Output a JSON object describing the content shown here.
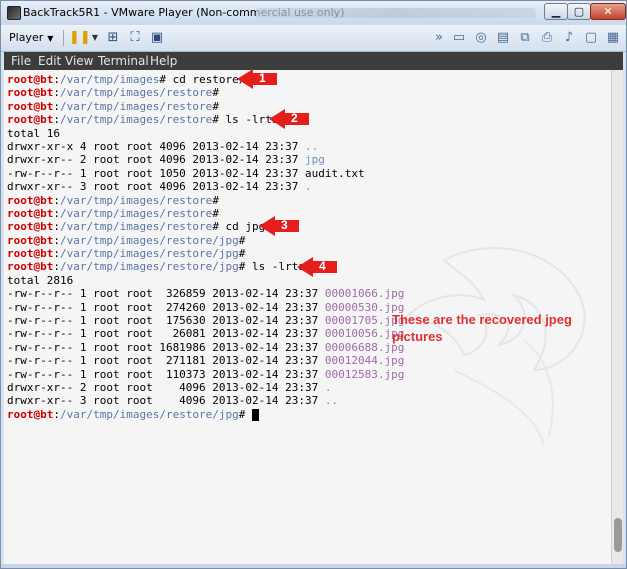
{
  "window": {
    "title": "BackTrack5R1 - VMware Player (Non-commercial use only)",
    "controls": {
      "minimize": "▁",
      "maximize": "▢",
      "close": "✕"
    }
  },
  "toolbar": {
    "player_label": "Player",
    "player_caret": "▼",
    "icons": [
      "pause-icon",
      "send-keys-icon",
      "fullscreen-icon",
      "forward-icon",
      "removable-device-icon",
      "network-icon",
      "usb-icon",
      "printer-icon",
      "sound-icon",
      "display-icon",
      "message-icon"
    ]
  },
  "menu": {
    "items": [
      "File",
      "Edit",
      "View",
      "Terminal",
      "Help"
    ]
  },
  "terminal": {
    "lines": [
      {
        "type": "prompt",
        "user": "root@bt",
        "path": "/var/tmp/images",
        "cmd": " cd restore/"
      },
      {
        "type": "prompt",
        "user": "root@bt",
        "path": "/var/tmp/images/restore",
        "cmd": ""
      },
      {
        "type": "prompt",
        "user": "root@bt",
        "path": "/var/tmp/images/restore",
        "cmd": ""
      },
      {
        "type": "prompt",
        "user": "root@bt",
        "path": "/var/tmp/images/restore",
        "cmd": " ls -lrta"
      },
      {
        "type": "text",
        "text": "total 16"
      },
      {
        "type": "entry",
        "meta": "drwxr-xr-x 4 root root 4096 2013-02-14 23:37 ",
        "name": "..",
        "kind": "dir"
      },
      {
        "type": "entry",
        "meta": "drwxr-xr-- 2 root root 4096 2013-02-14 23:37 ",
        "name": "jpg",
        "kind": "dir"
      },
      {
        "type": "entry",
        "meta": "-rw-r--r-- 1 root root 1050 2013-02-14 23:37 ",
        "name": "audit.txt",
        "kind": "plain"
      },
      {
        "type": "entry",
        "meta": "drwxr-xr-- 3 root root 4096 2013-02-14 23:37 ",
        "name": ".",
        "kind": "dir"
      },
      {
        "type": "prompt",
        "user": "root@bt",
        "path": "/var/tmp/images/restore",
        "cmd": ""
      },
      {
        "type": "prompt",
        "user": "root@bt",
        "path": "/var/tmp/images/restore",
        "cmd": ""
      },
      {
        "type": "prompt",
        "user": "root@bt",
        "path": "/var/tmp/images/restore",
        "cmd": " cd jpg"
      },
      {
        "type": "prompt",
        "user": "root@bt",
        "path": "/var/tmp/images/restore/jpg",
        "cmd": ""
      },
      {
        "type": "prompt",
        "user": "root@bt",
        "path": "/var/tmp/images/restore/jpg",
        "cmd": ""
      },
      {
        "type": "prompt",
        "user": "root@bt",
        "path": "/var/tmp/images/restore/jpg",
        "cmd": " ls -lrta"
      },
      {
        "type": "text",
        "text": "total 2816"
      },
      {
        "type": "entry",
        "meta": "-rw-r--r-- 1 root root  326859 2013-02-14 23:37 ",
        "name": "00001066.jpg",
        "kind": "file"
      },
      {
        "type": "entry",
        "meta": "-rw-r--r-- 1 root root  274260 2013-02-14 23:37 ",
        "name": "00000530.jpg",
        "kind": "file"
      },
      {
        "type": "entry",
        "meta": "-rw-r--r-- 1 root root  175630 2013-02-14 23:37 ",
        "name": "00001705.jpg",
        "kind": "file"
      },
      {
        "type": "entry",
        "meta": "-rw-r--r-- 1 root root   26081 2013-02-14 23:37 ",
        "name": "00010056.jpg",
        "kind": "file"
      },
      {
        "type": "entry",
        "meta": "-rw-r--r-- 1 root root 1681986 2013-02-14 23:37 ",
        "name": "00006688.jpg",
        "kind": "file"
      },
      {
        "type": "entry",
        "meta": "-rw-r--r-- 1 root root  271181 2013-02-14 23:37 ",
        "name": "00012044.jpg",
        "kind": "file"
      },
      {
        "type": "entry",
        "meta": "-rw-r--r-- 1 root root  110373 2013-02-14 23:37 ",
        "name": "00012583.jpg",
        "kind": "file"
      },
      {
        "type": "entry",
        "meta": "drwxr-xr-- 2 root root    4096 2013-02-14 23:37 ",
        "name": ".",
        "kind": "dir"
      },
      {
        "type": "entry",
        "meta": "drwxr-xr-- 3 root root    4096 2013-02-14 23:37 ",
        "name": "..",
        "kind": "dir"
      },
      {
        "type": "prompt",
        "user": "root@bt",
        "path": "/var/tmp/images/restore/jpg",
        "cmd": " ",
        "cursor": true
      }
    ]
  },
  "annotations": {
    "steps": [
      {
        "number": "1",
        "line": 0
      },
      {
        "number": "2",
        "line": 3
      },
      {
        "number": "3",
        "line": 11
      },
      {
        "number": "4",
        "line": 14
      }
    ],
    "note": "These are the recovered jpeg pictures",
    "color": "#e41d1d"
  }
}
